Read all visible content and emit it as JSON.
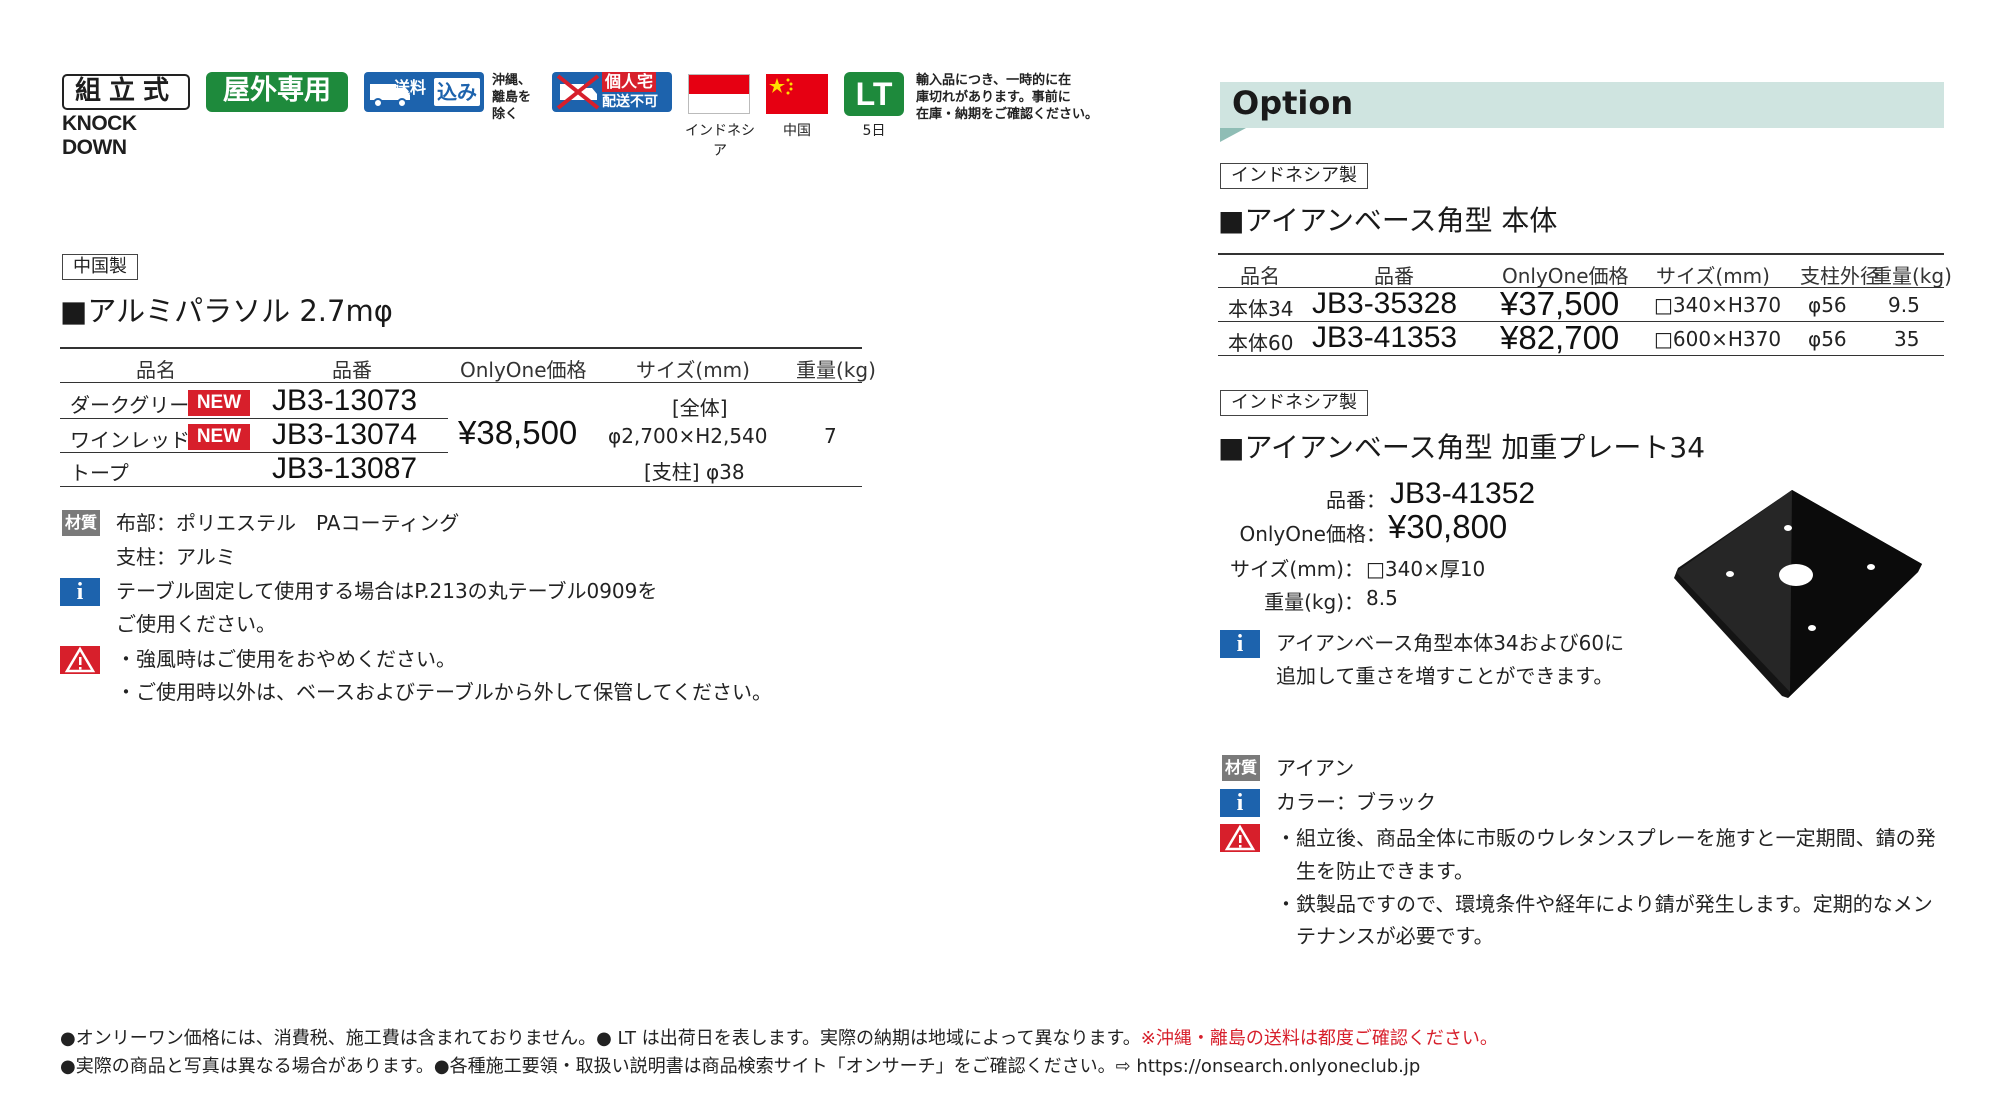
{
  "badges": {
    "knockdown_jp": "組立式",
    "knockdown_en": "KNOCK DOWN",
    "outdoor": "屋外専用",
    "shipping_label": "送料",
    "shipping_included": "込み",
    "shipping_note": [
      "沖縄、",
      "離島を",
      "除く"
    ],
    "no_home_1": "個人宅",
    "no_home_2": "配送不可",
    "flag1_caption": "インドネシア",
    "flag2_caption": "中国",
    "lt": "LT",
    "lt_caption": "5日",
    "import_note": [
      "輸入品につき、一時的に在",
      "庫切れがあります。事前に",
      "在庫・納期をご確認ください。"
    ],
    "colors": {
      "green": "#1e8a3c",
      "blue": "#1d63ad",
      "red": "#d71f2b",
      "indonesia_red": "#e60012",
      "china_red": "#e60012",
      "option_bar": "#cfe4e0"
    }
  },
  "left": {
    "made_in": "中国製",
    "title": "■アルミパラソル 2.7mφ",
    "headers": {
      "name": "品名",
      "code": "品番",
      "price": "OnlyOne価格",
      "size": "サイズ(mm)",
      "weight": "重量(kg)"
    },
    "rows": [
      {
        "name": "ダークグリーン",
        "new": "NEW",
        "code": "JB3-13073"
      },
      {
        "name": "ワインレッド",
        "new": "NEW",
        "code": "JB3-13074"
      },
      {
        "name": "トープ",
        "code": "JB3-13087"
      }
    ],
    "price": "¥38,500",
    "size_lines": [
      "[全体]",
      "φ2,700×H2,540",
      "[支柱] φ38"
    ],
    "weight": "7",
    "material_icon": "材質",
    "material_lines": [
      "布部：ポリエステル　PAコーティング",
      "支柱：アルミ"
    ],
    "info_icon": "i",
    "info_lines": [
      "テーブル固定して使用する場合はP.213の丸テーブル0909を",
      "ご使用ください。"
    ],
    "warn_lines": [
      "・強風時はご使用をおやめください。",
      "・ご使用時以外は、ベースおよびテーブルから外して保管してください。"
    ]
  },
  "right": {
    "option_label": "Option",
    "made_in_1": "インドネシア製",
    "title_1": "■アイアンベース角型 本体",
    "headers": {
      "name": "品名",
      "code": "品番",
      "price": "OnlyOne価格",
      "size": "サイズ(mm)",
      "diameter": "支柱外径",
      "weight": "重量(kg)"
    },
    "rows": [
      {
        "name": "本体34",
        "code": "JB3-35328",
        "price": "¥37,500",
        "size": "□340×H370",
        "diameter": "φ56",
        "weight": "9.5"
      },
      {
        "name": "本体60",
        "code": "JB3-41353",
        "price": "¥82,700",
        "size": "□600×H370",
        "diameter": "φ56",
        "weight": "35"
      }
    ],
    "made_in_2": "インドネシア製",
    "title_2": "■アイアンベース角型 加重プレート34",
    "spec": {
      "code_label": "品番：",
      "code": "JB3-41352",
      "price_label": "OnlyOne価格：",
      "price": "¥30,800",
      "size_label": "サイズ(mm)：",
      "size": "□340×厚10",
      "weight_label": "重量(kg)：",
      "weight": "8.5"
    },
    "plate_info_lines": [
      "アイアンベース角型本体34および60に",
      "追加して重さを増すことができます。"
    ],
    "material_icon": "材質",
    "material": "アイアン",
    "info_icon": "i",
    "color": "カラー：ブラック",
    "warn_lines": [
      "・組立後、商品全体に市販のウレタンスプレーを施すと一定期間、錆の発",
      "　生を防止できます。",
      "・鉄製品ですので、環境条件や経年により錆が発生します。定期的なメン",
      "　テナンスが必要です。"
    ]
  },
  "footer": {
    "line1": "●オンリーワン価格には、消費税、施工費は含まれておりません。● LT は出荷日を表します。実際の納期は地域によって異なります。",
    "line1_red": "※沖縄・離島の送料は都度ご確認ください。",
    "line2": "●実際の商品と写真は異なる場合があります。●各種施工要領・取扱い説明書は商品検索サイト「オンサーチ」をご確認ください。⇨ https://onsearch.onlyoneclub.jp"
  }
}
